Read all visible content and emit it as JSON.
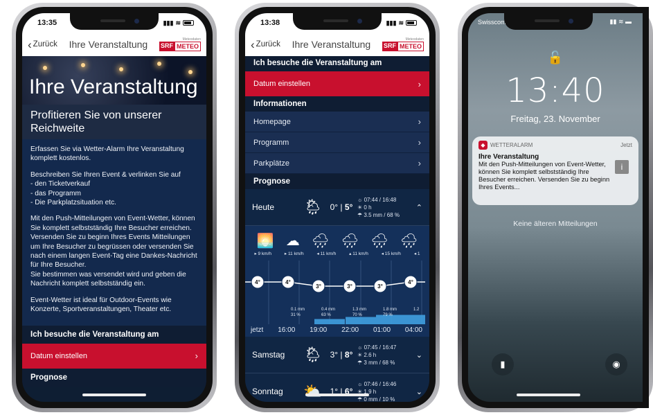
{
  "phone1": {
    "status_time": "13:35",
    "nav": {
      "back": "Zurück",
      "title": "Ihre Veranstaltung",
      "logo_small": "Meteodaten",
      "logo_srf": "SRF",
      "logo_meteo": "METEO"
    },
    "hero_title": "Ihre Veranstaltung",
    "subtitle": "Profitieren Sie von unserer Reichweite",
    "p1": "Erfassen Sie via Wetter-Alarm Ihre Veranstaltung komplett kostenlos.",
    "p2_lines": [
      "Beschreiben Sie Ihren Event & verlinken Sie auf",
      "- den Ticketverkauf",
      "- das Programm",
      "- Die Parkplatzsituation etc."
    ],
    "p3": "Mit den Push-Mitteilungen von Event-Wetter, können Sie komplett selbstständig Ihre Besucher erreichen. Versenden Sie zu beginn Ihres Events Mitteilungen um Ihre Besucher zu begrüssen oder versenden Sie nach einem langen Event-Tag eine Dankes-Nachricht für Ihre Besucher.",
    "p3b": "Sie bestimmen was versendet wird und geben die Nachricht komplett selbstständig ein.",
    "p4": "Event-Wetter ist ideal für Outdoor-Events wie Konzerte, Sportveranstaltungen, Theater etc.",
    "section_visit": "Ich besuche die Veranstaltung am",
    "date_button": "Datum einstellen",
    "section_prognose": "Prognose"
  },
  "phone2": {
    "status_time": "13:38",
    "nav": {
      "back": "Zurück",
      "title": "Ihre Veranstaltung",
      "logo_small": "Meteodaten",
      "logo_srf": "SRF",
      "logo_meteo": "METEO"
    },
    "section_visit": "Ich besuche die Veranstaltung am",
    "date_button": "Datum einstellen",
    "section_info": "Informationen",
    "info_items": [
      "Homepage",
      "Programm",
      "Parkplätze"
    ],
    "section_prognose": "Prognose",
    "days": [
      {
        "name": "Heute",
        "icon": "sun-cloud-rain-icon",
        "tmin": "0°",
        "tmax": "5°",
        "sun": "07:44 / 16:48",
        "hours": "0 h",
        "precip": "3.5 mm / 68 %",
        "toggle": "^"
      },
      {
        "name": "Samstag",
        "icon": "sun-cloud-rain-icon",
        "tmin": "3°",
        "tmax": "8°",
        "sun": "07:45 / 16:47",
        "hours": "2.6 h",
        "precip": "3 mm / 68 %",
        "toggle": "v"
      },
      {
        "name": "Sonntag",
        "icon": "sun-cloud-icon",
        "tmin": "1°",
        "tmax": "6°",
        "sun": "07:46 / 16:46",
        "hours": "1.9 h",
        "precip": "0 mm / 10 %",
        "toggle": "v"
      }
    ],
    "hourly": {
      "winds": [
        "▸ 9 km/h",
        "▸ 11 km/h",
        "◂ 11 km/h",
        "▴ 11 km/h",
        "◂ 15 km/h",
        "◂ 1"
      ],
      "temps": [
        "4°",
        "4°",
        "3°",
        "3°",
        "3°",
        "4°"
      ],
      "precip": [
        "",
        "0.1 mm\n31 %",
        "0.4 mm\n63 %",
        "1.3 mm\n70 %",
        "1.8 mm\n79 %",
        "1.2"
      ],
      "precip_fill": [
        0,
        0,
        0.25,
        0.35,
        0.45,
        0.45
      ],
      "times": [
        "jetzt",
        "16:00",
        "19:00",
        "22:00",
        "01:00",
        "04:00"
      ]
    }
  },
  "phone3": {
    "carrier": "Swisscom",
    "time": "13:40",
    "date": "Freitag, 23. November",
    "notif_app": "WETTERALARM",
    "notif_when": "Jetzt",
    "notif_title": "Ihre Veranstaltung",
    "notif_body": "Mit den Push-Mitteilungen von Event-Wetter, können Sie komplett selbstständig Ihre Besucher erreichen. Versenden Sie zu beginn Ihres Events...",
    "no_older": "Keine älteren Mitteilungen"
  }
}
